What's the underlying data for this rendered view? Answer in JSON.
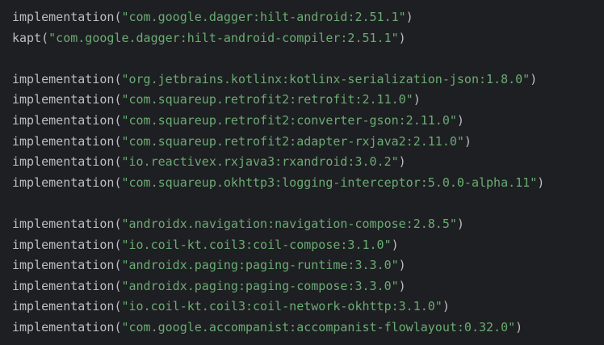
{
  "code_lines": [
    {
      "fn": "implementation",
      "open": "(",
      "str": "\"com.google.dagger:hilt-android:2.51.1\"",
      "close": ")"
    },
    {
      "fn": "kapt",
      "open": "(",
      "str": "\"com.google.dagger:hilt-android-compiler:2.51.1\"",
      "close": ")"
    },
    {
      "blank": true
    },
    {
      "fn": "implementation",
      "open": "(",
      "str": "\"org.jetbrains.kotlinx:kotlinx-serialization-json:1.8.0\"",
      "close": ")"
    },
    {
      "fn": "implementation",
      "open": "(",
      "str": "\"com.squareup.retrofit2:retrofit:2.11.0\"",
      "close": ")"
    },
    {
      "fn": "implementation",
      "open": "(",
      "str": "\"com.squareup.retrofit2:converter-gson:2.11.0\"",
      "close": ")"
    },
    {
      "fn": "implementation",
      "open": "(",
      "str": "\"com.squareup.retrofit2:adapter-rxjava2:2.11.0\"",
      "close": ")"
    },
    {
      "fn": "implementation",
      "open": "(",
      "str": "\"io.reactivex.rxjava3:rxandroid:3.0.2\"",
      "close": ")"
    },
    {
      "fn": "implementation",
      "open": "(",
      "str": "\"com.squareup.okhttp3:logging-interceptor:5.0.0-alpha.11\"",
      "close": ")"
    },
    {
      "blank": true
    },
    {
      "fn": "implementation",
      "open": "(",
      "str": "\"androidx.navigation:navigation-compose:2.8.5\"",
      "close": ")"
    },
    {
      "fn": "implementation",
      "open": "(",
      "str": "\"io.coil-kt.coil3:coil-compose:3.1.0\"",
      "close": ")"
    },
    {
      "fn": "implementation",
      "open": "(",
      "str": "\"androidx.paging:paging-runtime:3.3.0\"",
      "close": ")"
    },
    {
      "fn": "implementation",
      "open": "(",
      "str": "\"androidx.paging:paging-compose:3.3.0\"",
      "close": ")"
    },
    {
      "fn": "implementation",
      "open": "(",
      "str": "\"io.coil-kt.coil3:coil-network-okhttp:3.1.0\"",
      "close": ")"
    },
    {
      "fn": "implementation",
      "open": "(",
      "str": "\"com.google.accompanist:accompanist-flowlayout:0.32.0\"",
      "close": ")"
    }
  ],
  "colors": {
    "background": "#1e1f22",
    "function": "#bcbec4",
    "string": "#6aab73"
  }
}
